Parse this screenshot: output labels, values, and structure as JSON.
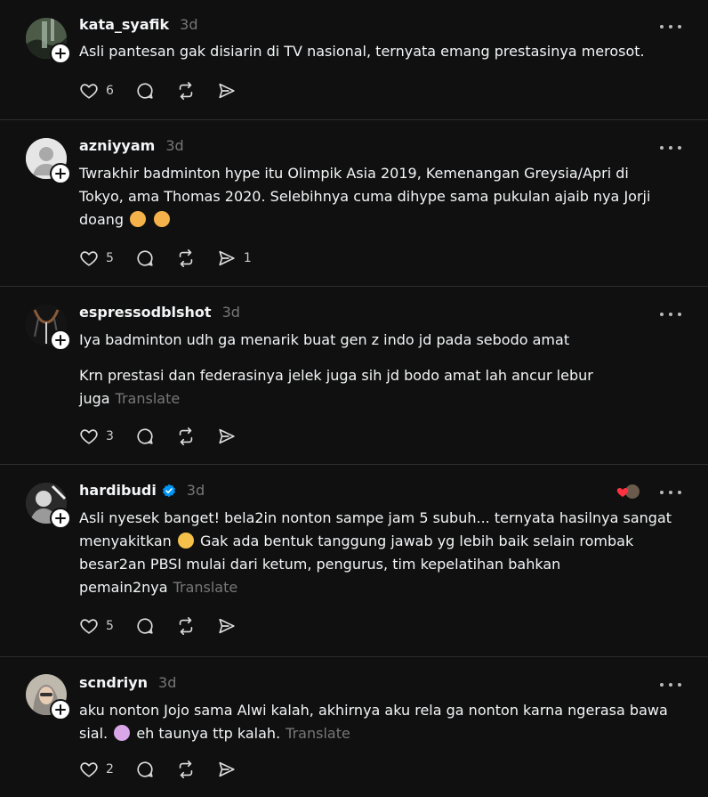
{
  "posts": [
    {
      "username": "kata_syafik",
      "time": "3d",
      "paragraphs": [
        "Asli pantesan gak disiarin di TV nasional, ternyata emang prestasinya merosot."
      ],
      "translate": "",
      "likes": "6",
      "reposts_count": ""
    },
    {
      "username": "azniyyam",
      "time": "3d",
      "paragraphs": [
        "Twrakhir badminton hype itu Olimpik Asia 2019, Kemenangan Greysia/Apri di Tokyo, ama Thomas 2020. Selebihnya cuma dihype sama pukulan ajaib nya Jorji doang"
      ],
      "translate": "",
      "likes": "5",
      "shares": "1"
    },
    {
      "username": "espressodblshot",
      "time": "3d",
      "paragraphs": [
        "Iya badminton udh ga menarik buat gen z indo jd pada sebodo amat",
        "Krn prestasi dan federasinya jelek juga sih jd bodo amat lah ancur lebur juga"
      ],
      "translate": "Translate",
      "likes": "3"
    },
    {
      "username": "hardibudi",
      "time": "3d",
      "paragraphs": [
        "Asli nyesek banget! bela2in nonton sampe jam 5 subuh... ternyata hasilnya sangat menyakitkan"
      ],
      "paragraph_cont": "Gak ada bentuk tanggung jawab yg lebih baik selain rombak besar2an PBSI mulai dari ketum, pengurus, tim kepelatihan bahkan pemain2nya",
      "translate": "Translate",
      "likes": "5"
    },
    {
      "username": "scndriyn",
      "time": "3d",
      "paragraphs": [
        "aku nonton Jojo sama Alwi kalah, akhirnya aku rela ga nonton karna ngerasa bawa sial."
      ],
      "paragraph_cont": "eh taunya ttp kalah.",
      "translate": "Translate",
      "likes": "2"
    }
  ],
  "icons": {
    "like": "heart-icon",
    "comment": "comment-icon",
    "repost": "repost-icon",
    "share": "share-icon",
    "more": "more-icon",
    "follow": "plus-icon",
    "verified": "verified-icon"
  },
  "colors": {
    "background": "#101010",
    "text": "#f3f5f7",
    "muted": "#777777",
    "divider": "#2d2d2d",
    "verified": "#0095f6"
  }
}
